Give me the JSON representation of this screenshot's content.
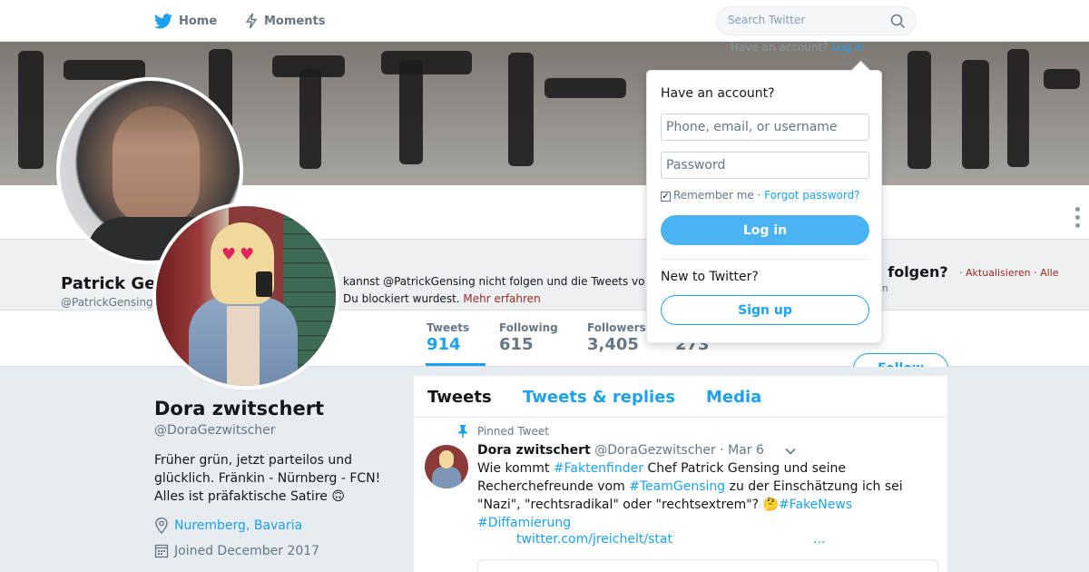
{
  "nav": {
    "home_label": "Home",
    "moments_label": "Moments",
    "search_placeholder": "Search Twitter",
    "have_account_text": "Have an account?",
    "login_link": "Log in"
  },
  "colors": {
    "accent": "#1da1f2",
    "login_button": "#4ab3f4",
    "muted_text": "#657786",
    "link_red": "#a0291f"
  },
  "underlying_profile": {
    "name": "Patrick Ge",
    "handle": "@PatrickGensing",
    "blocked_line1": "kannst @PatrickGensing nicht folgen und die Tweets vo",
    "blocked_line2": "Du blockiert wurdest.",
    "learn_more": "Mehr erfahren",
    "who_to_follow": "m folgen?",
    "who_to_follow_links": "· Aktualisieren · Alle",
    "who_to_follow_sub": "gen"
  },
  "login_dropdown": {
    "title": "Have an account?",
    "username_placeholder": "Phone, email, or username",
    "password_placeholder": "Password",
    "remember_label": "Remember me",
    "separator": " · ",
    "forgot_label": "Forgot password?",
    "login_button": "Log in",
    "new_to_twitter": "New to Twitter?",
    "signup_button": "Sign up"
  },
  "stats": {
    "tweets_label": "Tweets",
    "tweets_value": "914",
    "following_label": "Following",
    "following_value": "615",
    "followers_label": "Followers",
    "followers_value": "3,405",
    "likes_value": "273"
  },
  "profile": {
    "name": "Dora zwitschert",
    "handle": "@DoraGezwitscher",
    "bio": "Früher grün, jetzt parteilos und glücklich. Fränkin - Nürnberg - FCN! Alles ist präfaktische Satire 🙃",
    "location": "Nuremberg, Bavaria",
    "joined": "Joined December 2017",
    "follow_button": "Follow"
  },
  "timeline": {
    "tabs": [
      "Tweets",
      "Tweets & replies",
      "Media"
    ],
    "pinned_label": "Pinned Tweet",
    "tweet": {
      "name": "Dora zwitschert",
      "handle": "@DoraGezwitscher",
      "date": "· Mar 6",
      "text_1": "Wie kommt ",
      "tag_1": "#Faktenfinder",
      "text_2": " Chef Patrick Gensing und seine Recherchefreunde vom ",
      "tag_2": "#TeamGensing",
      "text_3": " zu der Einschätzung ich sei \"Nazi\", \"rechtsradikal\" oder \"rechtsextrem\"? 🤔",
      "tag_3": "#FakeNews",
      "tag_4": "#Diffamierung",
      "link": "twitter.com/jreichelt/stat",
      "ellipsis": "..."
    }
  }
}
